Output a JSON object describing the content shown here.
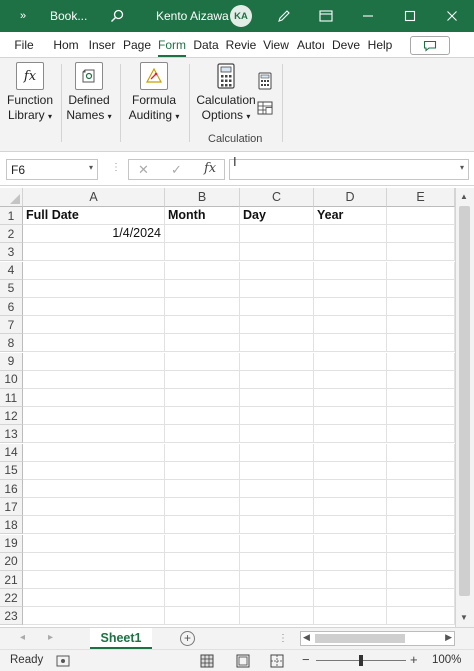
{
  "titlebar": {
    "book_name": "Book...",
    "user_name": "Kento Aizawa",
    "user_initials": "KA",
    "background_color": "#1e7145"
  },
  "ribbon_tabs": [
    {
      "label": "File",
      "active": false
    },
    {
      "label": "Hom",
      "active": false
    },
    {
      "label": "Inser",
      "active": false
    },
    {
      "label": "Page",
      "active": false
    },
    {
      "label": "Form",
      "active": true
    },
    {
      "label": "Data",
      "active": false
    },
    {
      "label": "Revie",
      "active": false
    },
    {
      "label": "View",
      "active": false
    },
    {
      "label": "Autoı",
      "active": false
    },
    {
      "label": "Deve",
      "active": false
    },
    {
      "label": "Help",
      "active": false
    }
  ],
  "ribbon": {
    "function_library": {
      "line1": "Function",
      "line2": "Library",
      "icon": "fx-icon"
    },
    "defined_names": {
      "line1": "Defined",
      "line2": "Names",
      "icon": "defined-names-icon"
    },
    "formula_auditing": {
      "line1": "Formula",
      "line2": "Auditing",
      "icon": "formula-auditing-icon"
    },
    "calculation_options": {
      "line1": "Calculation",
      "line2": "Options",
      "icon": "calculator-icon"
    },
    "calc_group_label": "Calculation"
  },
  "formula_bar": {
    "name_box": "F6",
    "fx_label": "fx",
    "formula_value": ""
  },
  "grid": {
    "columns": [
      "A",
      "B",
      "C",
      "D",
      "E"
    ],
    "rows": [
      "1",
      "2",
      "3",
      "4",
      "5",
      "6",
      "7",
      "8",
      "9",
      "10",
      "11",
      "12",
      "13",
      "14",
      "15",
      "16",
      "17",
      "18",
      "19",
      "20",
      "21",
      "22",
      "23"
    ],
    "header_cells": {
      "A1": "Full Date",
      "B1": "Month",
      "C1": "Day",
      "D1": "Year"
    },
    "A2": "1/4/2024"
  },
  "sheets": {
    "active": "Sheet1"
  },
  "status": {
    "ready": "Ready",
    "zoom": "100%",
    "zoom_minus": "−",
    "zoom_plus": "+"
  },
  "colors": {
    "accent": "#1e7145"
  }
}
